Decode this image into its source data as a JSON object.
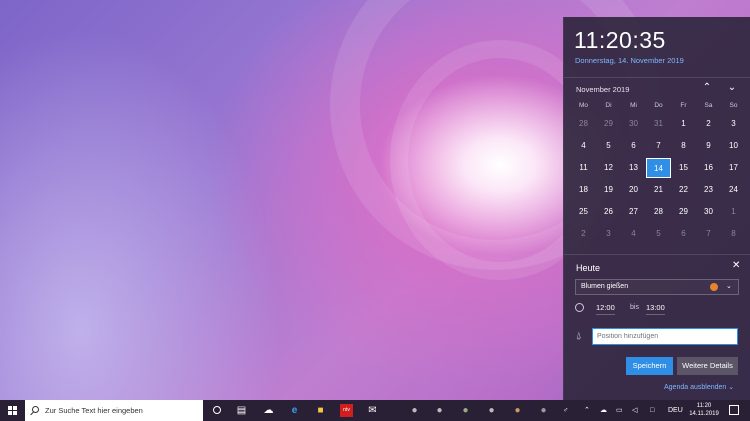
{
  "flyout": {
    "time": "11:20:35",
    "date": "Donnerstag, 14. November 2019",
    "month_label": "November 2019",
    "weekdays": [
      "Mo",
      "Di",
      "Mi",
      "Do",
      "Fr",
      "Sa",
      "So"
    ],
    "weeks": [
      [
        {
          "d": "28",
          "dim": true
        },
        {
          "d": "29",
          "dim": true
        },
        {
          "d": "30",
          "dim": true
        },
        {
          "d": "31",
          "dim": true
        },
        {
          "d": "1"
        },
        {
          "d": "2"
        },
        {
          "d": "3"
        }
      ],
      [
        {
          "d": "4"
        },
        {
          "d": "5"
        },
        {
          "d": "6"
        },
        {
          "d": "7"
        },
        {
          "d": "8"
        },
        {
          "d": "9"
        },
        {
          "d": "10"
        }
      ],
      [
        {
          "d": "11"
        },
        {
          "d": "12"
        },
        {
          "d": "13"
        },
        {
          "d": "14",
          "today": true
        },
        {
          "d": "15"
        },
        {
          "d": "16"
        },
        {
          "d": "17"
        }
      ],
      [
        {
          "d": "18"
        },
        {
          "d": "19"
        },
        {
          "d": "20"
        },
        {
          "d": "21"
        },
        {
          "d": "22"
        },
        {
          "d": "23"
        },
        {
          "d": "24"
        }
      ],
      [
        {
          "d": "25"
        },
        {
          "d": "26"
        },
        {
          "d": "27"
        },
        {
          "d": "28"
        },
        {
          "d": "29"
        },
        {
          "d": "30"
        },
        {
          "d": "1",
          "dim": true
        }
      ],
      [
        {
          "d": "2",
          "dim": true
        },
        {
          "d": "3",
          "dim": true
        },
        {
          "d": "4",
          "dim": true
        },
        {
          "d": "5",
          "dim": true
        },
        {
          "d": "6",
          "dim": true
        },
        {
          "d": "7",
          "dim": true
        },
        {
          "d": "8",
          "dim": true
        }
      ]
    ],
    "today_title": "Heute",
    "event_name": "Blumen gießen",
    "event_color": "#e8822e",
    "start_time": "12:00",
    "bis_label": "bis",
    "end_time": "13:00",
    "location_placeholder": "Position hinzufügen",
    "save_label": "Speichern",
    "more_label": "Weitere Details",
    "agenda_label": "Agenda ausblenden"
  },
  "taskbar": {
    "search_placeholder": "Zur Suche Text hier eingeben",
    "language": "DEU",
    "clock_time": "11:20",
    "clock_date": "14.11.2019"
  },
  "colors": {
    "accent": "#2f8fe6",
    "flyout_bg": "#302840",
    "taskbar_bg": "#2a2036"
  }
}
